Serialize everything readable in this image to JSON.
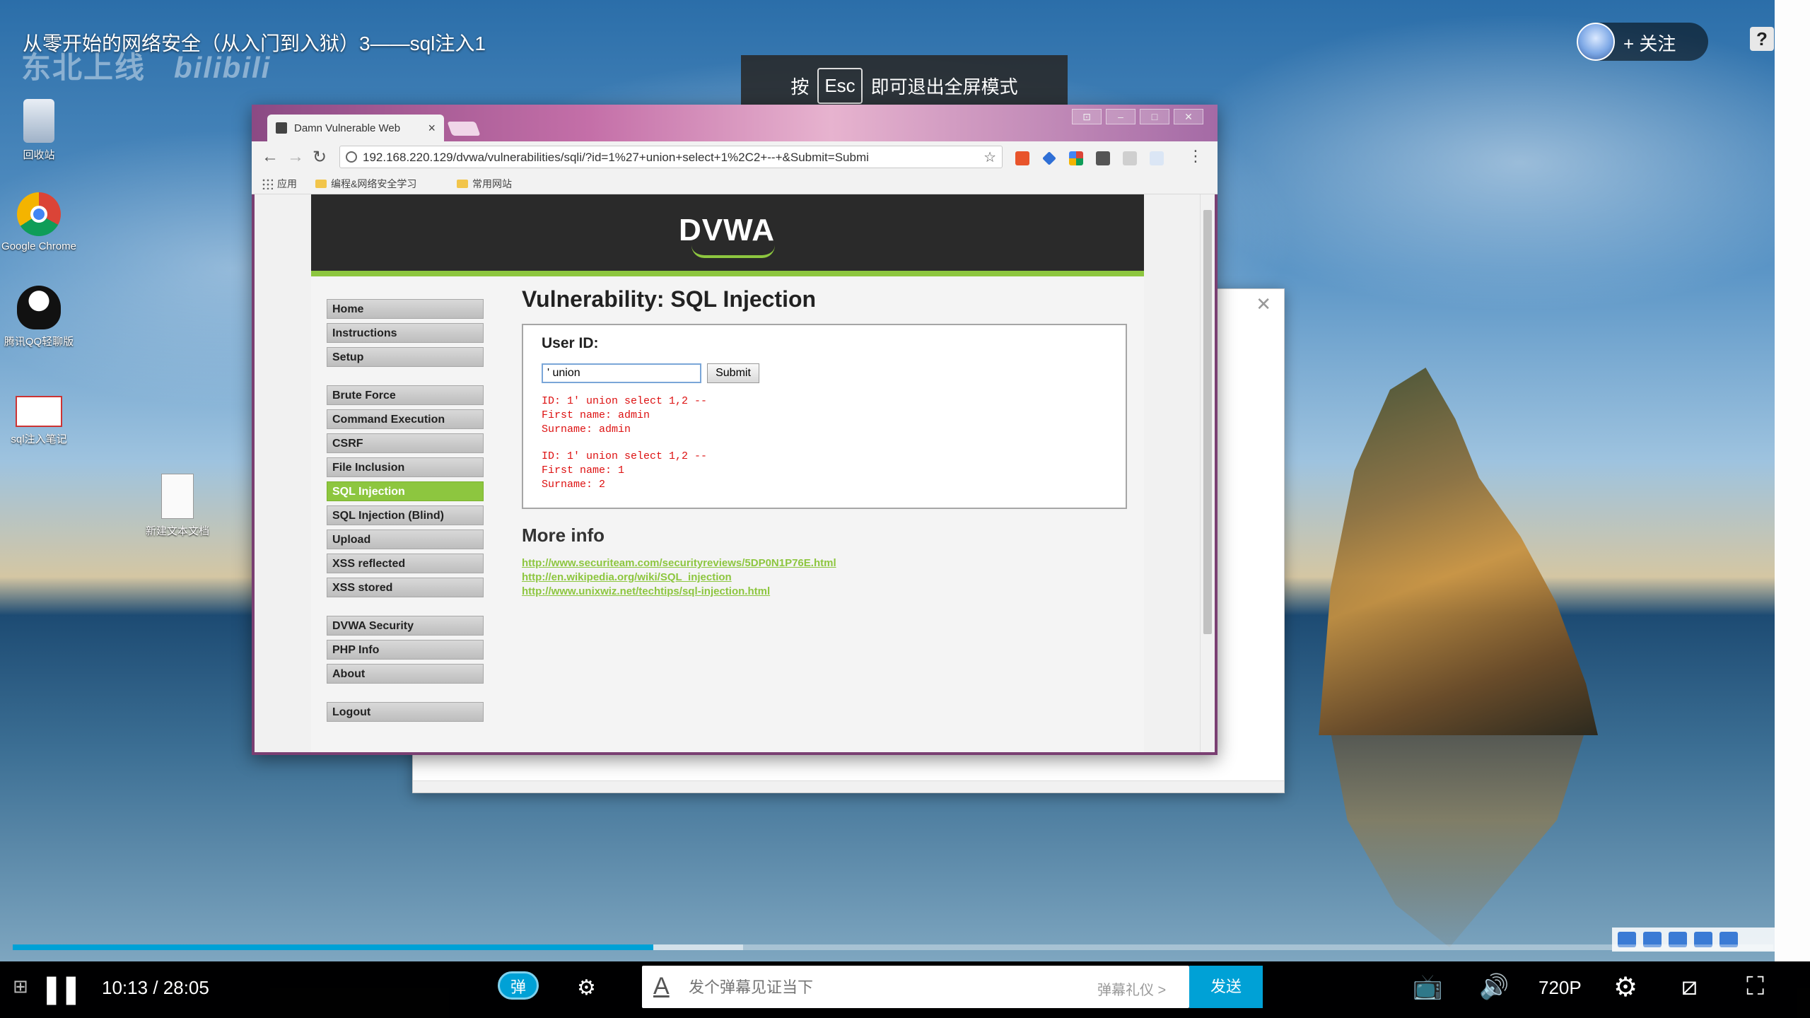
{
  "video": {
    "title": "从零开始的网络安全（从入门到入狱）3——sql注入1",
    "watermark_text": "东北上线",
    "watermark_brand": "bilibili",
    "follow_label": "+ 关注",
    "help_label": "?",
    "esc_tip": {
      "before": "按",
      "key": "Esc",
      "after": "即可退出全屏模式"
    }
  },
  "desktop_icons": [
    {
      "label": "回收站",
      "icon": "recycle-bin-icon"
    },
    {
      "label": "Google Chrome",
      "icon": "chrome-icon"
    },
    {
      "label": "腾讯QQ轻聊版",
      "icon": "qq-icon"
    },
    {
      "label": "sql注入笔记",
      "icon": "note-icon"
    },
    {
      "label": "新建文本文档",
      "icon": "text-file-icon"
    }
  ],
  "browser": {
    "tab_title": "Damn Vulnerable Web",
    "url": "192.168.220.129/dvwa/vulnerabilities/sqli/?id=1%27+union+select+1%2C2+--+&Submit=Submi",
    "bookmarks": [
      "应用",
      "编程&网络安全学习",
      "常用网站"
    ]
  },
  "dvwa": {
    "logo": "DVWA",
    "menu": [
      [
        "Home",
        "Instructions",
        "Setup"
      ],
      [
        "Brute Force",
        "Command Execution",
        "CSRF",
        "File Inclusion",
        "SQL Injection",
        "SQL Injection (Blind)",
        "Upload",
        "XSS reflected",
        "XSS stored"
      ],
      [
        "DVWA Security",
        "PHP Info",
        "About"
      ],
      [
        "Logout"
      ]
    ],
    "active_item": "SQL Injection",
    "page_title": "Vulnerability: SQL Injection",
    "user_id_label": "User ID:",
    "user_id_value": "' union",
    "submit_label": "Submit",
    "results": [
      {
        "id": "ID: 1' union select 1,2 --",
        "first": "First name: admin",
        "surname": "Surname: admin"
      },
      {
        "id": "ID: 1' union select 1,2 --",
        "first": "First name: 1",
        "surname": "Surname: 2"
      }
    ],
    "more_info_title": "More info",
    "links": [
      "http://www.securiteam.com/securityreviews/5DP0N1P76E.html",
      "http://en.wikipedia.org/wiki/SQL_injection",
      "http://www.unixwiz.net/techtips/sql-injection.html"
    ]
  },
  "player": {
    "current_time": "10:13",
    "separator": "/",
    "duration": "28:05",
    "progress_played_fraction": 0.364,
    "progress_buffered_fraction": 0.415,
    "danmaku_toggle": "弹",
    "danmaku_placeholder": "发个弹幕见证当下",
    "danmaku_etiquette": "弹幕礼仪 >",
    "send_label": "发送",
    "quality": "720P"
  },
  "colors": {
    "accent": "#00a1d6",
    "dvwa_green": "#8dc63f",
    "error_red": "#dd1111"
  }
}
